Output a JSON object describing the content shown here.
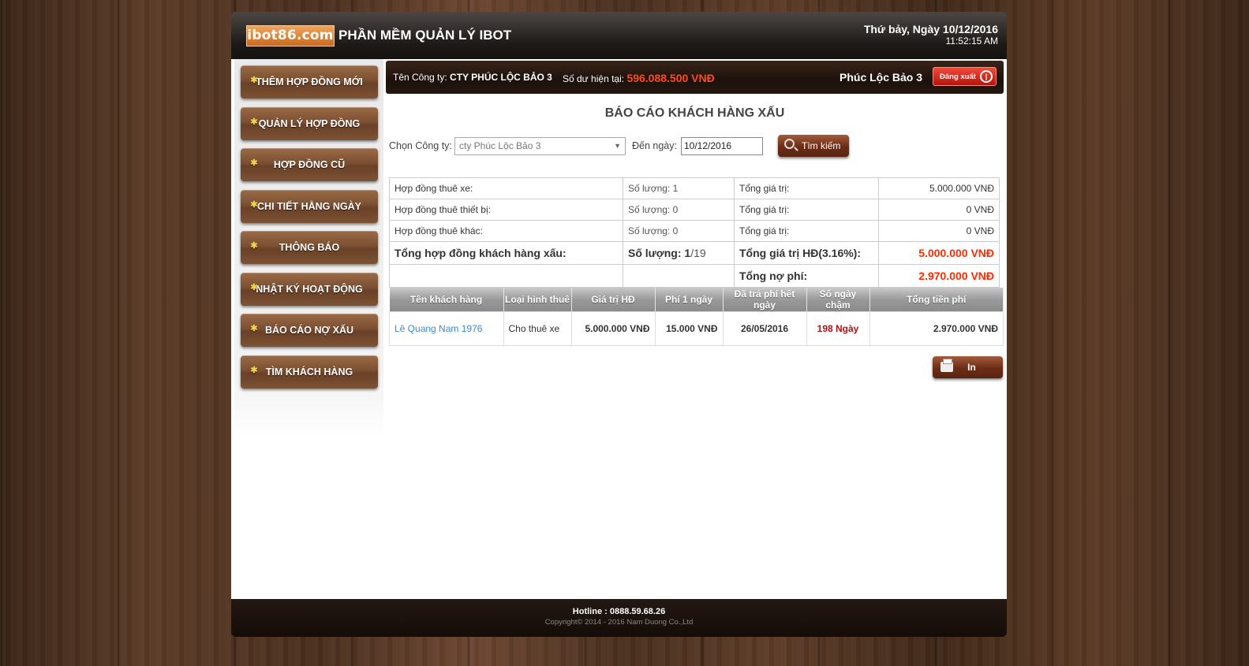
{
  "header": {
    "logo": "ibot86.com",
    "app_title": "PHẦN MỀM QUẢN LÝ IBOT",
    "date": "Thứ bảy, Ngày 10/12/2016",
    "time": "11:52:15 AM"
  },
  "sidebar": {
    "items": [
      {
        "label": "THÊM HỢP ĐỒNG MỚI"
      },
      {
        "label": "QUẢN LÝ HỢP ĐỒNG"
      },
      {
        "label": "HỢP ĐỒNG CŨ"
      },
      {
        "label": "CHI TIẾT HẰNG NGÀY"
      },
      {
        "label": "THÔNG BÁO"
      },
      {
        "label": "NHẬT KÝ HOẠT ĐỘNG"
      },
      {
        "label": "BÁO CÁO NỢ XẤU"
      },
      {
        "label": "TÌM KHÁCH HÀNG"
      }
    ]
  },
  "infobar": {
    "company_label": "Tên Công ty:",
    "company_name": "CTY PHÚC LỘC BẢO 3",
    "balance_label": "Số dư hiện tại:",
    "balance": "596.088.500 VNĐ",
    "user": "Phúc Lộc Bảo 3",
    "logout_label": "Đăng xuất"
  },
  "page_title": "BÁO CÁO KHÁCH HÀNG XẤU",
  "filter": {
    "company_label": "Chọn Công ty:",
    "company_value": "cty Phúc Lộc Bảo 3",
    "date_label": "Đến ngày:",
    "date_value": "10/12/2016",
    "search_label": "Tìm kiếm"
  },
  "summary": {
    "rows": [
      {
        "name": "Hợp đồng thuê xe:",
        "qty": "Số lượng: 1",
        "total_label": "Tổng giá trị:",
        "total": "5.000.000 VNĐ"
      },
      {
        "name": "Hợp đồng thuê thiết bị:",
        "qty": "Số lượng: 0",
        "total_label": "Tổng giá trị:",
        "total": "0 VNĐ"
      },
      {
        "name": "Hợp đồng thuê khác:",
        "qty": "Số lượng: 0",
        "total_label": "Tổng giá trị:",
        "total": "0 VNĐ"
      }
    ],
    "bad_label": "Tổng hợp đồng khách hàng xấu:",
    "bad_qty_label": "Số lượng:",
    "bad_qty": "1",
    "bad_qty_total": "/19",
    "bad_value_label": "Tổng giá trị HĐ(3.16%):",
    "bad_value": "5.000.000 VNĐ",
    "debt_label": "Tổng nợ phí:",
    "debt_value": "2.970.000 VNĐ"
  },
  "detail": {
    "headers": [
      "Tên khách hàng",
      "Loại hình thuê",
      "Giá trị HĐ",
      "Phí 1 ngày",
      "Đã trả phí hết ngày",
      "Số ngày chậm",
      "Tổng tiền phí"
    ],
    "rows": [
      {
        "customer": "Lê Quang Nam 1976",
        "type": "Cho thuê xe",
        "value": "5.000.000 VNĐ",
        "fee": "15.000 VNĐ",
        "paid_until": "26/05/2016",
        "late": "198 Ngày",
        "total_fee": "2.970.000 VNĐ"
      }
    ]
  },
  "print_label": "In",
  "footer": {
    "hotline": "Hotline : 0888.59.68.26",
    "copyright": "Copyright© 2014 - 2016  Nam Duong Co.,Ltd"
  }
}
